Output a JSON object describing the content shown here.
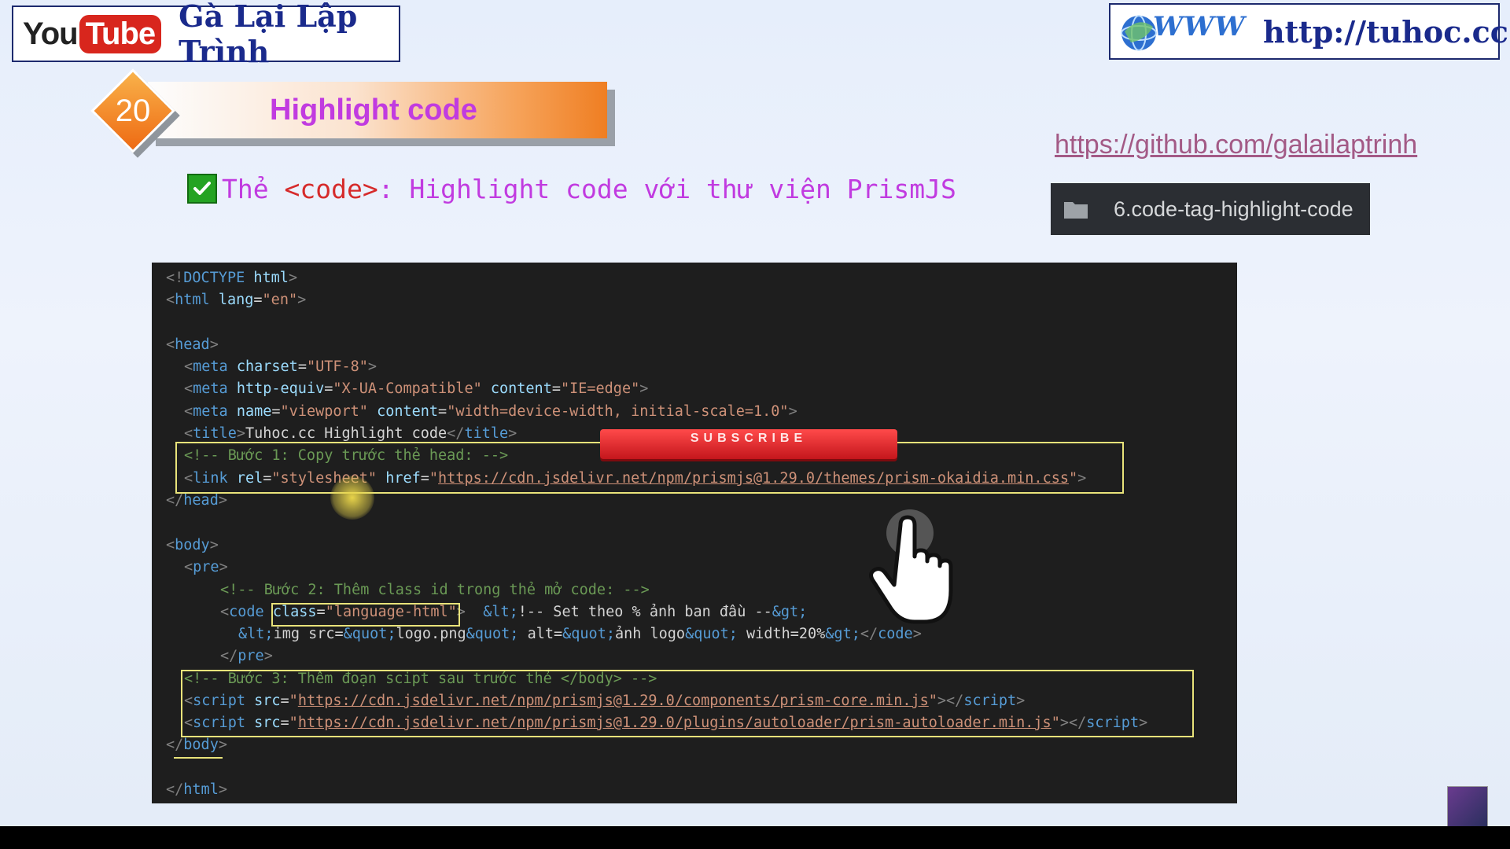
{
  "header": {
    "yt_you": "You",
    "yt_tube": "Tube",
    "channel_name": "Gà Lại Lập Trình",
    "www_badge": "WWW",
    "site_url": "http://tuhoc.cc"
  },
  "lesson": {
    "number": "20",
    "title": "Highlight code"
  },
  "github": {
    "url": "https://github.com/galailaptrinh",
    "folder_icon": "folder-icon",
    "folder_label": "6.code-tag-highlight-code"
  },
  "subtitle": {
    "icon": "check-icon",
    "prefix": "Thẻ ",
    "tag": "<code>",
    "rest": ": Highlight code với thư viện PrismJS"
  },
  "overlay": {
    "subscribe_text": "SUBSCRIBE",
    "cursor_icon": "hand-pointer-icon"
  },
  "code": {
    "l1_a": "<!",
    "l1_b": "DOCTYPE",
    "l1_c": " html",
    "l1_d": ">",
    "l2_tag": "html",
    "l2_attr": " lang",
    "l2_val": "\"en\"",
    "l4_tag": "head",
    "l5_tag": "meta",
    "l5_attr": " charset",
    "l5_val": "\"UTF-8\"",
    "l6_tag": "meta",
    "l6_attr1": " http-equiv",
    "l6_val1": "\"X-UA-Compatible\"",
    "l6_attr2": " content",
    "l6_val2": "\"IE=edge\"",
    "l7_tag": "meta",
    "l7_attr1": " name",
    "l7_val1": "\"viewport\"",
    "l7_attr2": " content",
    "l7_val2": "\"width=device-width, initial-scale=1.0\"",
    "l8_tag": "title",
    "l8_text": "Tuhoc.cc Highlight code",
    "l8_close": "title",
    "l9_comment": "<!-- Bước 1: Copy trước thẻ head: -->",
    "l10_tag": "link",
    "l10_attr1": " rel",
    "l10_val1": "\"stylesheet\"",
    "l10_attr2": " href",
    "l10_url": "https://cdn.jsdelivr.net/npm/prismjs@1.29.0/themes/prism-okaidia.min.css",
    "l11_tag": "head",
    "l13_tag": "body",
    "l14_tag": "pre",
    "l15_comment": "<!-- Bước 2: Thêm class id trong thẻ mở code: -->",
    "l16_tag": "code",
    "l16_attr": "class",
    "l16_val": "\"language-html\"",
    "l16_e1": "&lt;",
    "l16_text": "!-- Set theo % ảnh ban đầu --",
    "l16_e2": "&gt;",
    "l17_e1": "&lt;",
    "l17_t1": "img src=",
    "l17_e2": "&quot;",
    "l17_t2": "logo.png",
    "l17_e3": "&quot;",
    "l17_t3": " alt=",
    "l17_e4": "&quot;",
    "l17_t4": "ảnh logo",
    "l17_e5": "&quot;",
    "l17_t5": " width=20%",
    "l17_e6": "&gt;",
    "l17_close": "code",
    "l18_tag": "pre",
    "l19_comment": "<!-- Bước 3: Thêm đoạn scipt sau trước thẻ </body> -->",
    "l20_tag": "script",
    "l20_attr": " src",
    "l20_url": "https://cdn.jsdelivr.net/npm/prismjs@1.29.0/components/prism-core.min.js",
    "l20_close": "script",
    "l21_tag": "script",
    "l21_attr": " src",
    "l21_url": "https://cdn.jsdelivr.net/npm/prismjs@1.29.0/plugins/autoloader/prism-autoloader.min.js",
    "l21_close": "script",
    "l22_tag": "body",
    "l24_tag": "html"
  },
  "colors": {
    "accent_purple": "#c13be0",
    "brand_navy": "#1a2a8c",
    "youtube_red": "#d8261d",
    "highlight_box": "#e9e37a"
  }
}
